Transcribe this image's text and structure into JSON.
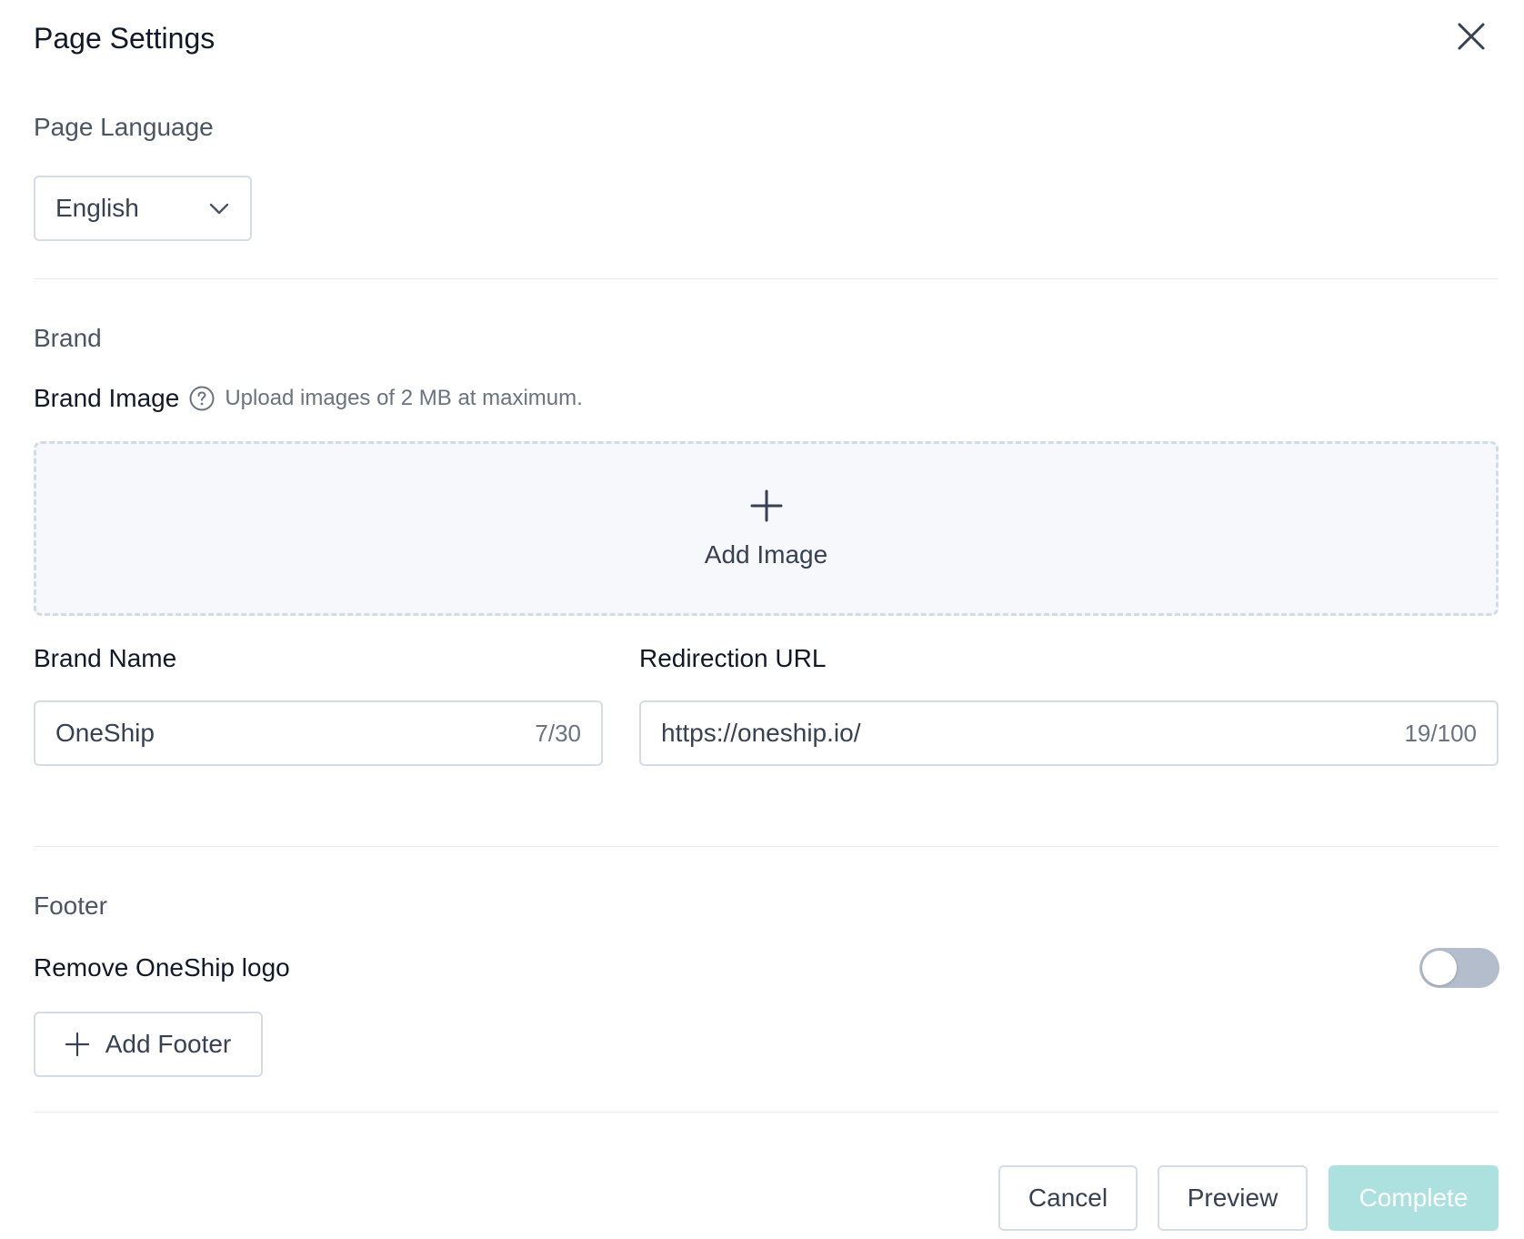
{
  "header": {
    "title": "Page Settings",
    "close_icon": "close-icon"
  },
  "language": {
    "section_title": "Page Language",
    "selected": "English",
    "chevron_icon": "chevron-down-icon"
  },
  "brand": {
    "section_title": "Brand",
    "image_label": "Brand Image",
    "help_icon": "question-circle-icon",
    "image_hint": "Upload images of 2 MB at maximum.",
    "add_image_label": "Add Image",
    "name_label": "Brand Name",
    "name_value": "OneShip",
    "name_counter": "7/30",
    "url_label": "Redirection URL",
    "url_value": "https://oneship.io/",
    "url_counter": "19/100"
  },
  "footer": {
    "section_title": "Footer",
    "remove_logo_label": "Remove OneShip logo",
    "remove_logo_enabled": false,
    "add_footer_label": "Add Footer"
  },
  "actions": {
    "cancel": "Cancel",
    "preview": "Preview",
    "complete": "Complete",
    "complete_disabled": true
  },
  "colors": {
    "primary_disabled": "#ace1df",
    "border": "#d6dce4",
    "toggle_off": "#b4bdcb",
    "upload_bg": "#f6f8fb"
  }
}
